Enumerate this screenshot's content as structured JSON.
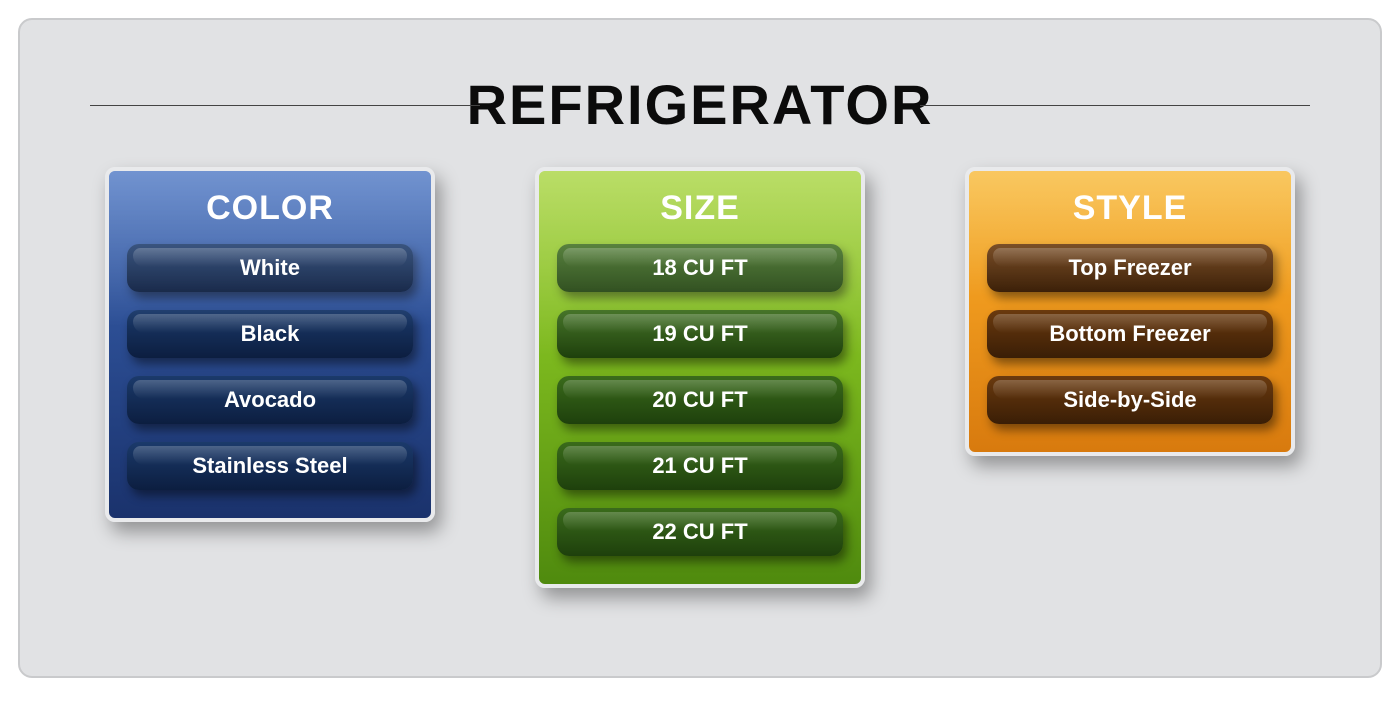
{
  "title": "REFRIGERATOR",
  "cards": {
    "color": {
      "heading": "COLOR",
      "options": [
        "White",
        "Black",
        "Avocado",
        "Stainless Steel"
      ]
    },
    "size": {
      "heading": "SIZE",
      "options": [
        "18 CU FT",
        "19 CU FT",
        "20 CU FT",
        "21 CU FT",
        "22 CU FT"
      ]
    },
    "style": {
      "heading": "STYLE",
      "options": [
        "Top Freezer",
        "Bottom Freezer",
        "Side-by-Side"
      ]
    }
  }
}
